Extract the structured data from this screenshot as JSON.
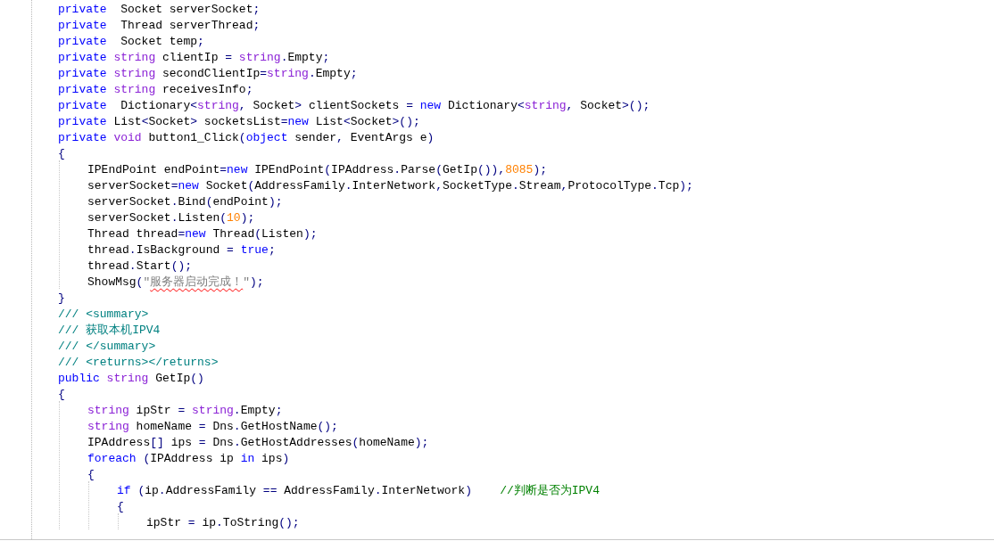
{
  "code": [
    {
      "tokens": [
        {
          "kind": "keyword",
          "text": "private"
        },
        {
          "kind": "plain",
          "text": "  Socket serverSocket"
        },
        {
          "kind": "punct",
          "text": ";"
        }
      ]
    },
    {
      "tokens": [
        {
          "kind": "keyword",
          "text": "private"
        },
        {
          "kind": "plain",
          "text": "  Thread serverThread"
        },
        {
          "kind": "punct",
          "text": ";"
        }
      ]
    },
    {
      "tokens": [
        {
          "kind": "keyword",
          "text": "private"
        },
        {
          "kind": "plain",
          "text": "  Socket temp"
        },
        {
          "kind": "punct",
          "text": ";"
        }
      ]
    },
    {
      "tokens": [
        {
          "kind": "keyword",
          "text": "private"
        },
        {
          "kind": "type",
          "text": " string"
        },
        {
          "kind": "plain",
          "text": " clientIp "
        },
        {
          "kind": "punct",
          "text": "="
        },
        {
          "kind": "type",
          "text": " string"
        },
        {
          "kind": "punct",
          "text": "."
        },
        {
          "kind": "plain",
          "text": "Empty"
        },
        {
          "kind": "punct",
          "text": ";"
        }
      ]
    },
    {
      "tokens": [
        {
          "kind": "keyword",
          "text": "private"
        },
        {
          "kind": "type",
          "text": " string"
        },
        {
          "kind": "plain",
          "text": " secondClientIp"
        },
        {
          "kind": "punct",
          "text": "="
        },
        {
          "kind": "type",
          "text": "string"
        },
        {
          "kind": "punct",
          "text": "."
        },
        {
          "kind": "plain",
          "text": "Empty"
        },
        {
          "kind": "punct",
          "text": ";"
        }
      ]
    },
    {
      "tokens": [
        {
          "kind": "keyword",
          "text": "private"
        },
        {
          "kind": "type",
          "text": " string"
        },
        {
          "kind": "plain",
          "text": " receivesInfo"
        },
        {
          "kind": "punct",
          "text": ";"
        }
      ]
    },
    {
      "tokens": [
        {
          "kind": "keyword",
          "text": "private"
        },
        {
          "kind": "plain",
          "text": "  Dictionary"
        },
        {
          "kind": "punct",
          "text": "<"
        },
        {
          "kind": "type",
          "text": "string"
        },
        {
          "kind": "punct",
          "text": ","
        },
        {
          "kind": "plain",
          "text": " Socket"
        },
        {
          "kind": "punct",
          "text": ">"
        },
        {
          "kind": "plain",
          "text": " clientSockets "
        },
        {
          "kind": "punct",
          "text": "="
        },
        {
          "kind": "keyword",
          "text": " new"
        },
        {
          "kind": "plain",
          "text": " Dictionary"
        },
        {
          "kind": "punct",
          "text": "<"
        },
        {
          "kind": "type",
          "text": "string"
        },
        {
          "kind": "punct",
          "text": ","
        },
        {
          "kind": "plain",
          "text": " Socket"
        },
        {
          "kind": "punct",
          "text": ">();"
        }
      ]
    },
    {
      "tokens": [
        {
          "kind": "keyword",
          "text": "private"
        },
        {
          "kind": "plain",
          "text": " List"
        },
        {
          "kind": "punct",
          "text": "<"
        },
        {
          "kind": "plain",
          "text": "Socket"
        },
        {
          "kind": "punct",
          "text": ">"
        },
        {
          "kind": "plain",
          "text": " socketsList"
        },
        {
          "kind": "punct",
          "text": "="
        },
        {
          "kind": "keyword",
          "text": "new"
        },
        {
          "kind": "plain",
          "text": " List"
        },
        {
          "kind": "punct",
          "text": "<"
        },
        {
          "kind": "plain",
          "text": "Socket"
        },
        {
          "kind": "punct",
          "text": ">();"
        }
      ]
    },
    {
      "tokens": [
        {
          "kind": "keyword",
          "text": "private"
        },
        {
          "kind": "type",
          "text": " void"
        },
        {
          "kind": "plain",
          "text": " button1_Click"
        },
        {
          "kind": "punct",
          "text": "("
        },
        {
          "kind": "keyword",
          "text": "object"
        },
        {
          "kind": "plain",
          "text": " sender"
        },
        {
          "kind": "punct",
          "text": ","
        },
        {
          "kind": "plain",
          "text": " EventArgs e"
        },
        {
          "kind": "punct",
          "text": ")"
        }
      ]
    },
    {
      "tokens": [
        {
          "kind": "punct",
          "text": "{"
        }
      ]
    },
    {
      "children": [
        {
          "tokens": [
            {
              "kind": "plain",
              "text": "IPEndPoint endPoint"
            },
            {
              "kind": "punct",
              "text": "="
            },
            {
              "kind": "keyword",
              "text": "new"
            },
            {
              "kind": "plain",
              "text": " IPEndPoint"
            },
            {
              "kind": "punct",
              "text": "("
            },
            {
              "kind": "plain",
              "text": "IPAddress"
            },
            {
              "kind": "punct",
              "text": "."
            },
            {
              "kind": "plain",
              "text": "Parse"
            },
            {
              "kind": "punct",
              "text": "("
            },
            {
              "kind": "plain",
              "text": "GetIp"
            },
            {
              "kind": "punct",
              "text": "()),"
            },
            {
              "kind": "number",
              "text": "8085"
            },
            {
              "kind": "punct",
              "text": ");"
            }
          ]
        },
        {
          "tokens": [
            {
              "kind": "plain",
              "text": "serverSocket"
            },
            {
              "kind": "punct",
              "text": "="
            },
            {
              "kind": "keyword",
              "text": "new"
            },
            {
              "kind": "plain",
              "text": " Socket"
            },
            {
              "kind": "punct",
              "text": "("
            },
            {
              "kind": "plain",
              "text": "AddressFamily"
            },
            {
              "kind": "punct",
              "text": "."
            },
            {
              "kind": "plain",
              "text": "InterNetwork"
            },
            {
              "kind": "punct",
              "text": ","
            },
            {
              "kind": "plain",
              "text": "SocketType"
            },
            {
              "kind": "punct",
              "text": "."
            },
            {
              "kind": "plain",
              "text": "Stream"
            },
            {
              "kind": "punct",
              "text": ","
            },
            {
              "kind": "plain",
              "text": "ProtocolType"
            },
            {
              "kind": "punct",
              "text": "."
            },
            {
              "kind": "plain",
              "text": "Tcp"
            },
            {
              "kind": "punct",
              "text": ");"
            }
          ]
        },
        {
          "tokens": [
            {
              "kind": "plain",
              "text": "serverSocket"
            },
            {
              "kind": "punct",
              "text": "."
            },
            {
              "kind": "plain",
              "text": "Bind"
            },
            {
              "kind": "punct",
              "text": "("
            },
            {
              "kind": "plain",
              "text": "endPoint"
            },
            {
              "kind": "punct",
              "text": ");"
            }
          ]
        },
        {
          "tokens": [
            {
              "kind": "plain",
              "text": "serverSocket"
            },
            {
              "kind": "punct",
              "text": "."
            },
            {
              "kind": "plain",
              "text": "Listen"
            },
            {
              "kind": "punct",
              "text": "("
            },
            {
              "kind": "number",
              "text": "10"
            },
            {
              "kind": "punct",
              "text": ");"
            }
          ]
        },
        {
          "tokens": [
            {
              "kind": "plain",
              "text": "Thread thread"
            },
            {
              "kind": "punct",
              "text": "="
            },
            {
              "kind": "keyword",
              "text": "new"
            },
            {
              "kind": "plain",
              "text": " Thread"
            },
            {
              "kind": "punct",
              "text": "("
            },
            {
              "kind": "plain",
              "text": "Listen"
            },
            {
              "kind": "punct",
              "text": ");"
            }
          ]
        },
        {
          "tokens": [
            {
              "kind": "plain",
              "text": "thread"
            },
            {
              "kind": "punct",
              "text": "."
            },
            {
              "kind": "plain",
              "text": "IsBackground "
            },
            {
              "kind": "punct",
              "text": "="
            },
            {
              "kind": "keyword",
              "text": " true"
            },
            {
              "kind": "punct",
              "text": ";"
            }
          ]
        },
        {
          "tokens": [
            {
              "kind": "plain",
              "text": "thread"
            },
            {
              "kind": "punct",
              "text": "."
            },
            {
              "kind": "plain",
              "text": "Start"
            },
            {
              "kind": "punct",
              "text": "();"
            }
          ]
        },
        {
          "tokens": [
            {
              "kind": "plain",
              "text": "ShowMsg"
            },
            {
              "kind": "punct",
              "text": "("
            },
            {
              "kind": "string",
              "text": "\""
            },
            {
              "kind": "string",
              "text": "服务器启动完成！",
              "misspelled": true
            },
            {
              "kind": "string",
              "text": "\""
            },
            {
              "kind": "punct",
              "text": ");"
            }
          ]
        }
      ]
    },
    {
      "tokens": [
        {
          "kind": "punct",
          "text": "}"
        }
      ]
    },
    {
      "tokens": [
        {
          "kind": "doc",
          "text": "/// <summary>"
        }
      ]
    },
    {
      "tokens": [
        {
          "kind": "doc",
          "text": "/// 获取本机IPV4"
        }
      ]
    },
    {
      "tokens": [
        {
          "kind": "doc",
          "text": "/// </summary>"
        }
      ]
    },
    {
      "tokens": [
        {
          "kind": "doc",
          "text": "/// <returns></returns>"
        }
      ]
    },
    {
      "tokens": [
        {
          "kind": "keyword",
          "text": "public"
        },
        {
          "kind": "type",
          "text": " string"
        },
        {
          "kind": "plain",
          "text": " GetIp"
        },
        {
          "kind": "punct",
          "text": "()"
        }
      ]
    },
    {
      "tokens": [
        {
          "kind": "punct",
          "text": "{"
        }
      ]
    },
    {
      "children": [
        {
          "tokens": [
            {
              "kind": "type",
              "text": "string"
            },
            {
              "kind": "plain",
              "text": " ipStr "
            },
            {
              "kind": "punct",
              "text": "="
            },
            {
              "kind": "type",
              "text": " string"
            },
            {
              "kind": "punct",
              "text": "."
            },
            {
              "kind": "plain",
              "text": "Empty"
            },
            {
              "kind": "punct",
              "text": ";"
            }
          ]
        },
        {
          "tokens": [
            {
              "kind": "type",
              "text": "string"
            },
            {
              "kind": "plain",
              "text": " homeName "
            },
            {
              "kind": "punct",
              "text": "="
            },
            {
              "kind": "plain",
              "text": " Dns"
            },
            {
              "kind": "punct",
              "text": "."
            },
            {
              "kind": "plain",
              "text": "GetHostName"
            },
            {
              "kind": "punct",
              "text": "();"
            }
          ]
        },
        {
          "tokens": [
            {
              "kind": "plain",
              "text": "IPAddress"
            },
            {
              "kind": "punct",
              "text": "[]"
            },
            {
              "kind": "plain",
              "text": " ips "
            },
            {
              "kind": "punct",
              "text": "="
            },
            {
              "kind": "plain",
              "text": " Dns"
            },
            {
              "kind": "punct",
              "text": "."
            },
            {
              "kind": "plain",
              "text": "GetHostAddresses"
            },
            {
              "kind": "punct",
              "text": "("
            },
            {
              "kind": "plain",
              "text": "homeName"
            },
            {
              "kind": "punct",
              "text": ");"
            }
          ]
        },
        {
          "tokens": [
            {
              "kind": "keyword",
              "text": "foreach"
            },
            {
              "kind": "punct",
              "text": " ("
            },
            {
              "kind": "plain",
              "text": "IPAddress ip "
            },
            {
              "kind": "keyword",
              "text": "in"
            },
            {
              "kind": "plain",
              "text": " ips"
            },
            {
              "kind": "punct",
              "text": ")"
            }
          ]
        },
        {
          "tokens": [
            {
              "kind": "punct",
              "text": "{"
            }
          ]
        },
        {
          "children": [
            {
              "tokens": [
                {
                  "kind": "keyword",
                  "text": "if"
                },
                {
                  "kind": "punct",
                  "text": " ("
                },
                {
                  "kind": "plain",
                  "text": "ip"
                },
                {
                  "kind": "punct",
                  "text": "."
                },
                {
                  "kind": "plain",
                  "text": "AddressFamily "
                },
                {
                  "kind": "punct",
                  "text": "=="
                },
                {
                  "kind": "plain",
                  "text": " AddressFamily"
                },
                {
                  "kind": "punct",
                  "text": "."
                },
                {
                  "kind": "plain",
                  "text": "InterNetwork"
                },
                {
                  "kind": "punct",
                  "text": ")"
                },
                {
                  "kind": "comment",
                  "text": "    //判断是否为IPV4"
                }
              ]
            },
            {
              "tokens": [
                {
                  "kind": "punct",
                  "text": "{"
                }
              ]
            },
            {
              "children": [
                {
                  "tokens": [
                    {
                      "kind": "plain",
                      "text": "ipStr "
                    },
                    {
                      "kind": "punct",
                      "text": "="
                    },
                    {
                      "kind": "plain",
                      "text": " ip"
                    },
                    {
                      "kind": "punct",
                      "text": "."
                    },
                    {
                      "kind": "plain",
                      "text": "ToString"
                    },
                    {
                      "kind": "punct",
                      "text": "();"
                    }
                  ]
                }
              ]
            }
          ]
        }
      ]
    }
  ]
}
